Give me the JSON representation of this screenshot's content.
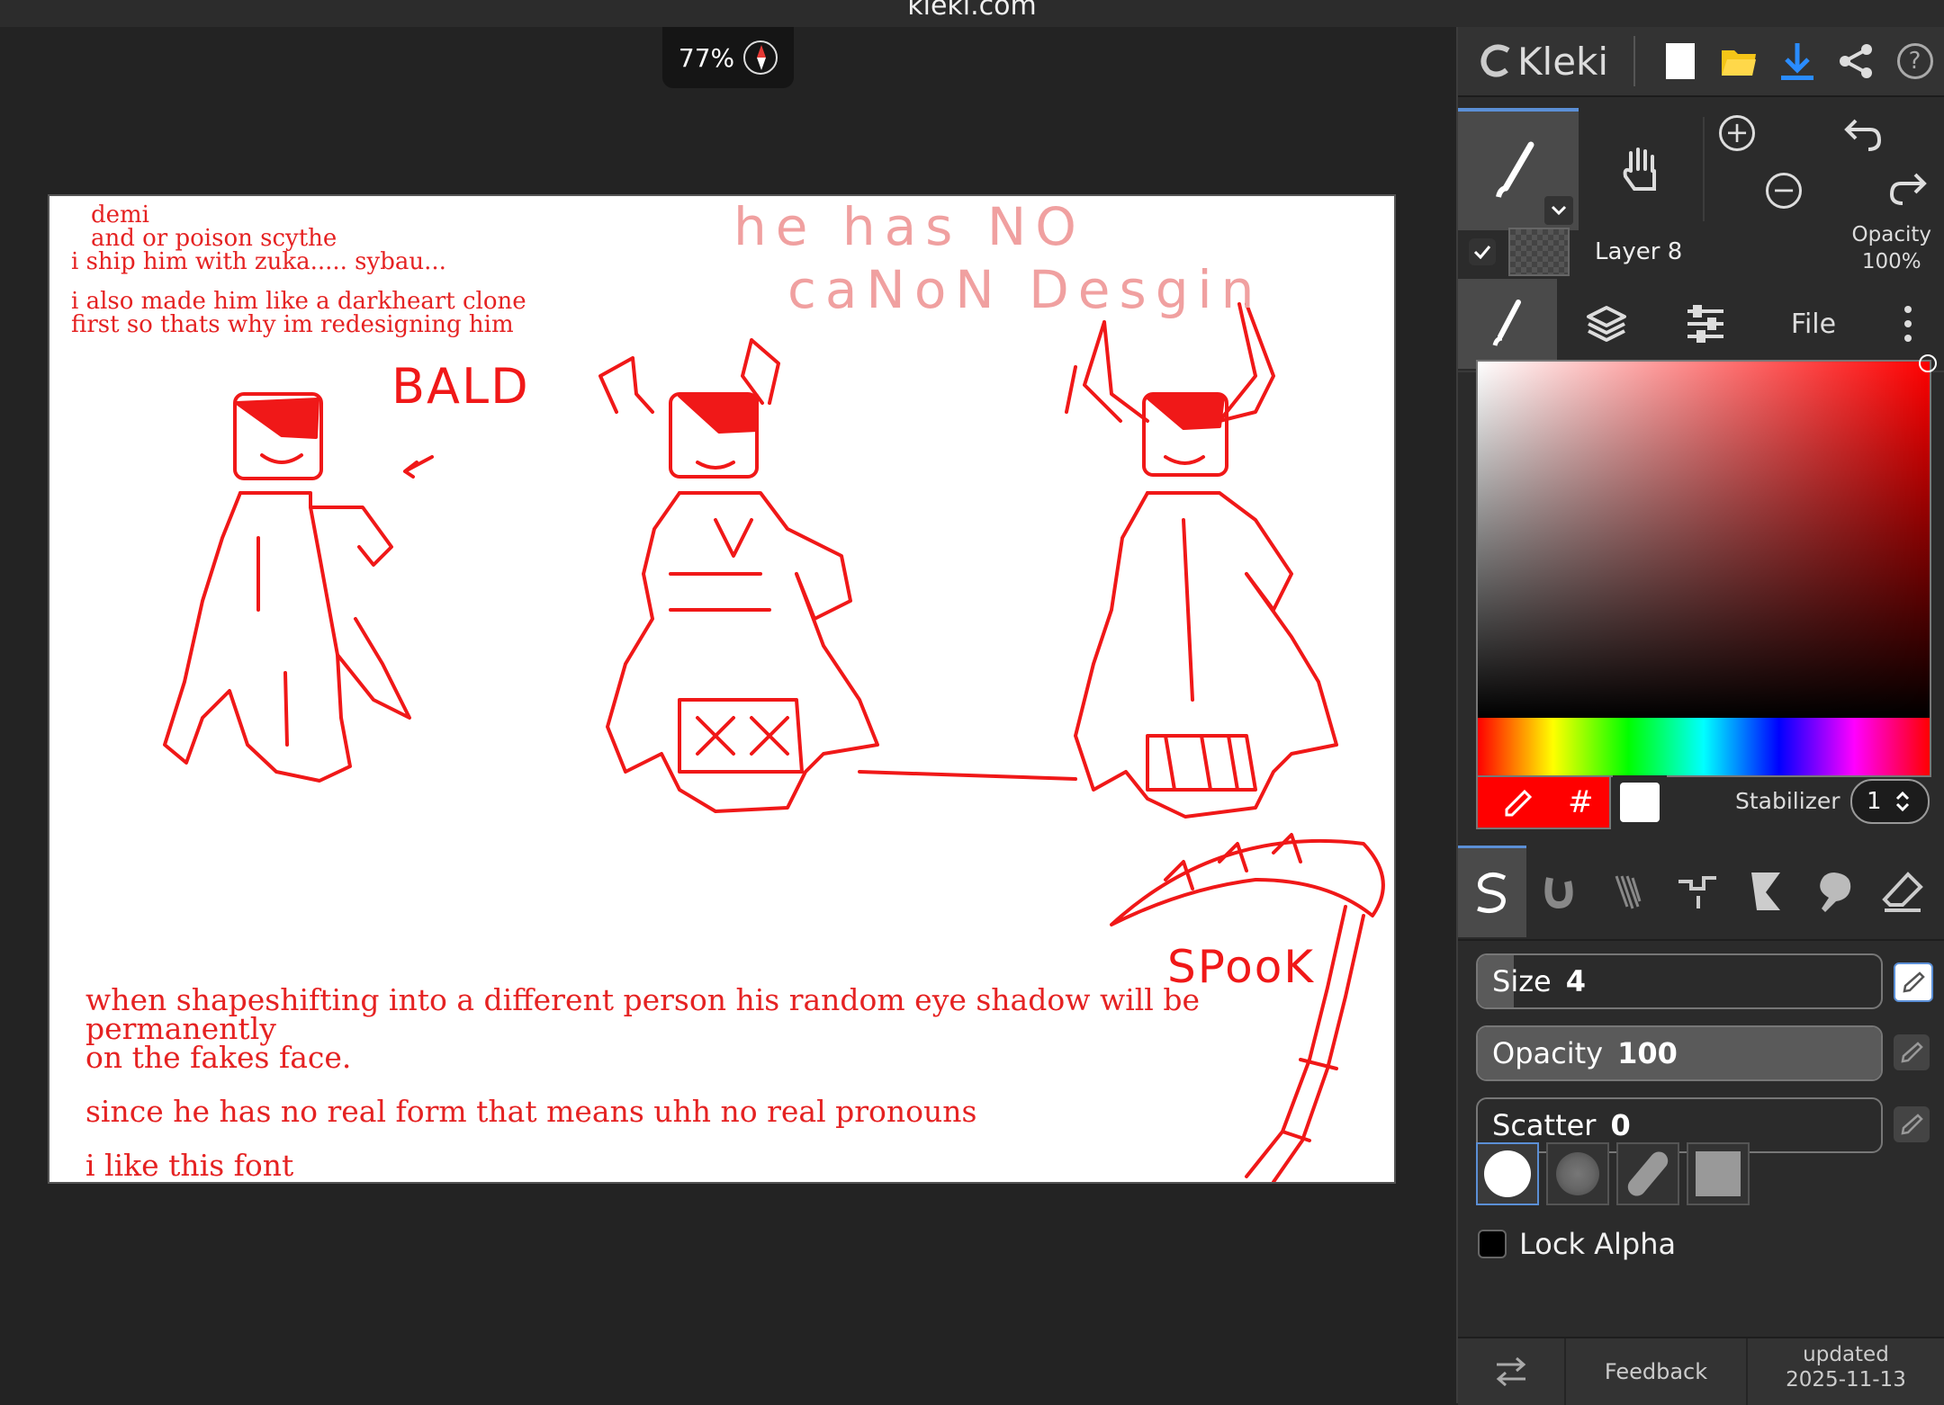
{
  "window": {
    "title": "kleki.com"
  },
  "zoom": {
    "label": "77%"
  },
  "canvas": {
    "notes_top": [
      "demi",
      "and or poison scythe",
      "i ship him with zuka..... sybau...",
      "i also made him like a darkheart clone",
      "first so thats why im redesigning him"
    ],
    "handwriting": {
      "line1": "he has NO",
      "line2": "caNoN Desgin",
      "bald": "BALD",
      "spook": "SPooK"
    },
    "notes_bottom": [
      "when shapeshifting into a different person his random eye shadow will be permanently",
      "on the fakes face.",
      "since he has no real form that means uhh no real pronouns",
      "i like this font"
    ]
  },
  "panel": {
    "app_name": "Kleki",
    "toolbar_icons": [
      "new-image-icon",
      "open-folder-icon",
      "download-icon",
      "share-icon",
      "help-icon"
    ],
    "layer": {
      "name": "Layer 8",
      "opacity_label": "Opacity",
      "opacity_value": "100%"
    },
    "tabs": {
      "file": "File"
    },
    "color": {
      "hash": "#",
      "stabilizer_label": "Stabilizer",
      "stabilizer_value": "1",
      "primary": "#ff0000",
      "secondary": "#ffffff"
    },
    "sliders": [
      {
        "label": "Size",
        "value": "4",
        "fraction": 0.09
      },
      {
        "label": "Opacity",
        "value": "100",
        "fraction": 1.0
      },
      {
        "label": "Scatter",
        "value": "0",
        "fraction": 0.0
      }
    ],
    "lock_alpha": "Lock Alpha",
    "footer": {
      "feedback": "Feedback",
      "updated_label": "updated",
      "updated_date": "2025-11-13"
    }
  }
}
